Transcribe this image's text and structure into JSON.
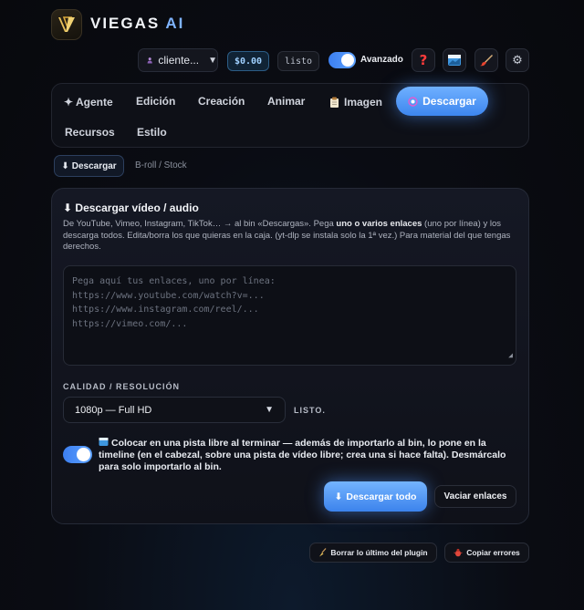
{
  "app": {
    "title_main": "VIEGAS",
    "title_accent": "AI"
  },
  "topbar": {
    "user_label": "cliente...",
    "balance": "$0.00",
    "status": "listo",
    "advanced_label": "Avanzado",
    "advanced_on": true,
    "icons": [
      "help-icon",
      "clapper-icon",
      "brush-icon",
      "gear-icon"
    ]
  },
  "tabs": [
    {
      "label": "✦ Agente"
    },
    {
      "label": "Edición"
    },
    {
      "label": "Creación"
    },
    {
      "label": "Animar"
    },
    {
      "label": "Imagen"
    },
    {
      "label": "Descargar",
      "active": true
    },
    {
      "label": "Recursos"
    },
    {
      "label": "Estilo"
    }
  ],
  "subtabs": {
    "active": "Descargar",
    "other": "B-roll / Stock"
  },
  "card": {
    "title": "Descargar vídeo / audio",
    "desc_a": "De YouTube, Vimeo, Instagram, TikTok… → al bin «Descargas». Pega ",
    "desc_b": "uno o varios enlaces",
    "desc_c": " (uno por línea) y los descarga todos. Edita/borra los que quieras en la caja. (yt-dlp se instala solo la 1ª vez.) Para material del que tengas derechos.",
    "placeholder": "Pega aquí tus enlaces, uno por línea:\nhttps://www.youtube.com/watch?v=...\nhttps://www.instagram.com/reel/...\nhttps://vimeo.com/...",
    "quality_label": "CALIDAD / RESOLUCIÓN",
    "quality_value": "1080p — Full HD",
    "ready_text": "LISTO.",
    "track_text": "Colocar en una pista libre al terminar — además de importarlo al bin, lo pone en la timeline (en el cabezal, sobre una pista de vídeo libre; crea una si hace falta). Desmárcalo para solo importarlo al bin.",
    "track_on": true,
    "download_all": "Descargar todo",
    "clear_links": "Vaciar enlaces"
  },
  "footer": {
    "clear_last": "Borrar lo último del plugin",
    "copy_errors": "Copiar errores"
  }
}
